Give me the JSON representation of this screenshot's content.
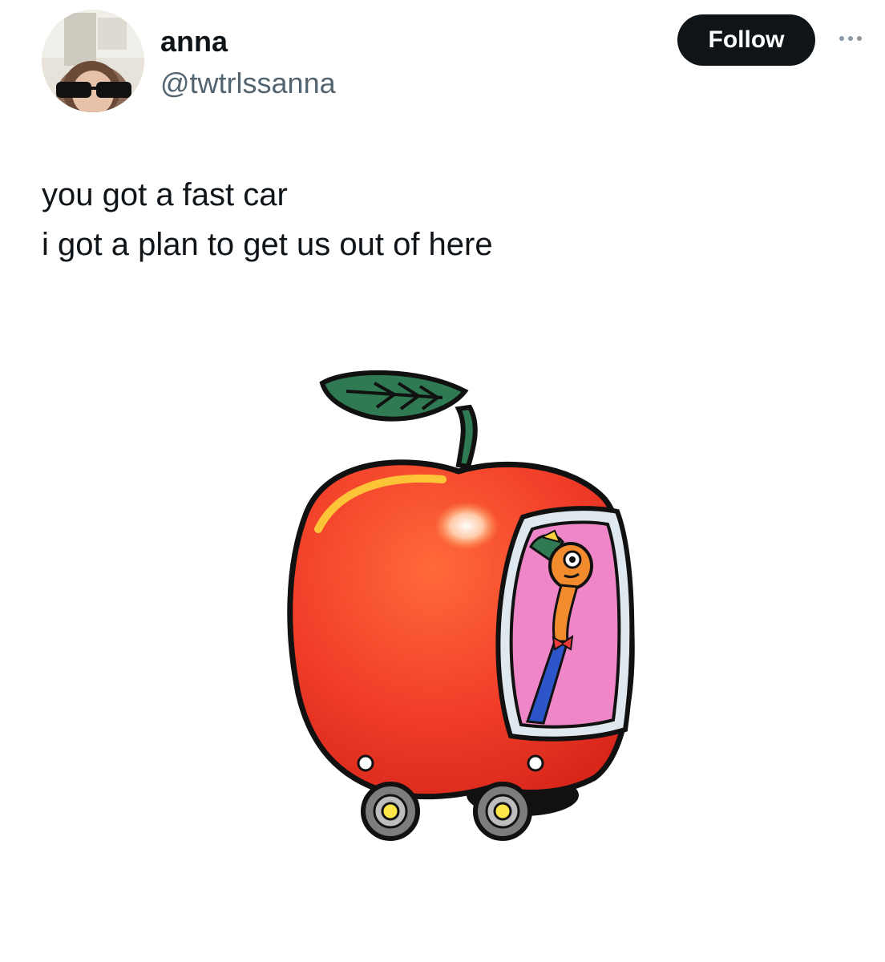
{
  "tweet": {
    "author": {
      "display_name": "anna",
      "handle": "@twtrlssanna"
    },
    "follow_label": "Follow",
    "more_icon": "more-horizontal-icon",
    "text_lines": [
      "you got a fast car",
      "i got a plan to get us out of here"
    ]
  },
  "colors": {
    "follow_bg": "#0f1419",
    "follow_text": "#ffffff",
    "handle_text": "#536471",
    "body_text": "#0f1419",
    "apple_red": "#f2402a",
    "leaf_green": "#2f7a52",
    "window_pink": "#ef86c8"
  }
}
